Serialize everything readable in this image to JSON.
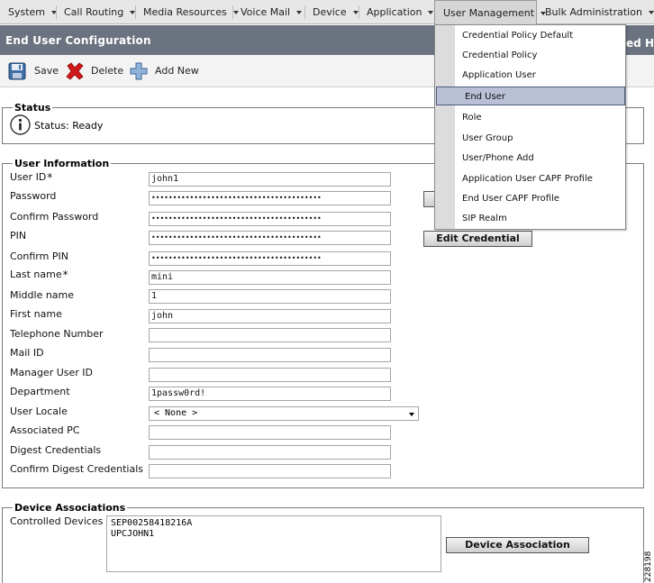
{
  "menubar": {
    "items": [
      {
        "label": "System"
      },
      {
        "label": "Call Routing"
      },
      {
        "label": "Media Resources"
      },
      {
        "label": "Voice Mail"
      },
      {
        "label": "Device"
      },
      {
        "label": "Application"
      },
      {
        "label": "User Management"
      },
      {
        "label": "Bulk Administration"
      }
    ]
  },
  "titlebar": {
    "title": "End User Configuration",
    "right_fragment": "ed H"
  },
  "toolbar": {
    "save_label": "Save",
    "delete_label": "Delete",
    "add_new_label": "Add New"
  },
  "status": {
    "legend": "Status",
    "text": "Status: Ready"
  },
  "user_info": {
    "legend": "User Information",
    "fields": [
      {
        "label": "User ID",
        "value": "john1",
        "required": "*"
      },
      {
        "label": "Password",
        "value": "••••••••••••••••••••••••••••••••••••••••"
      },
      {
        "label": "Confirm Password",
        "value": "••••••••••••••••••••••••••••••••••••••••"
      },
      {
        "label": "PIN",
        "value": "••••••••••••••••••••••••••••••••••••••••"
      },
      {
        "label": "Confirm PIN",
        "value": "••••••••••••••••••••••••••••••••••••••••"
      },
      {
        "label": "Last name",
        "value": "mini",
        "required": "*"
      },
      {
        "label": "Middle name",
        "value": "1"
      },
      {
        "label": "First name",
        "value": "john"
      },
      {
        "label": "Telephone Number",
        "value": ""
      },
      {
        "label": "Mail ID",
        "value": ""
      },
      {
        "label": "Manager User ID",
        "value": ""
      },
      {
        "label": "Department",
        "value": "1passw0rd!"
      },
      {
        "label": "User Locale",
        "value": "< None >"
      },
      {
        "label": "Associated PC",
        "value": ""
      },
      {
        "label": "Digest Credentials",
        "value": ""
      },
      {
        "label": "Confirm Digest Credentials",
        "value": ""
      }
    ],
    "edit_credential_label": "Edit Credential"
  },
  "device_assoc": {
    "legend": "Device Associations",
    "label": "Controlled Devices",
    "devices": [
      "SEP00258418216A",
      "UPCJOHN1"
    ],
    "button_label": "Device Association"
  },
  "dropdown": {
    "items": [
      {
        "label": "Credential Policy Default"
      },
      {
        "label": "Credential Policy"
      },
      {
        "label": "Application User"
      },
      {
        "label": "End User"
      },
      {
        "label": "Role"
      },
      {
        "label": "User Group"
      },
      {
        "label": "User/Phone Add"
      },
      {
        "label": "Application User CAPF Profile"
      },
      {
        "label": "End User CAPF Profile"
      },
      {
        "label": "SIP Realm"
      }
    ]
  },
  "figure_number": "228198"
}
